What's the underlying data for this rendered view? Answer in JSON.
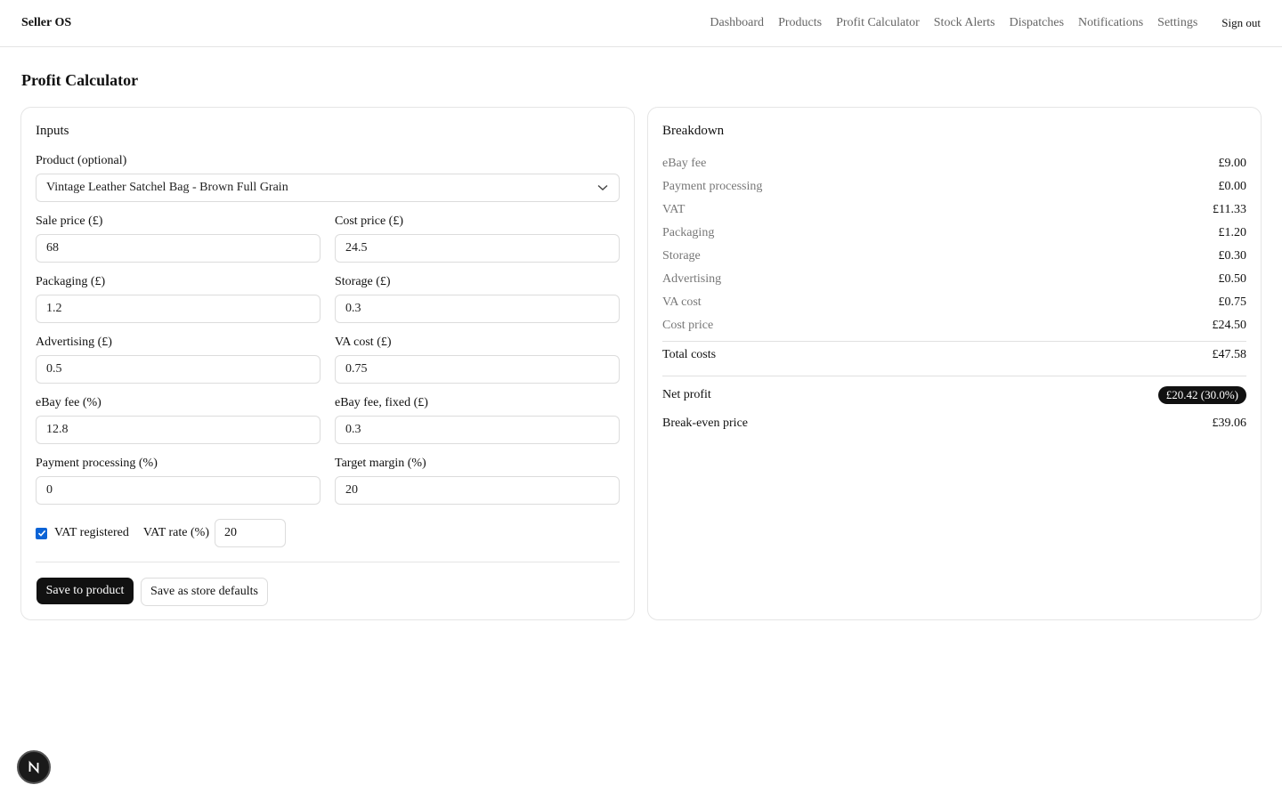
{
  "header": {
    "brand": "Seller OS",
    "nav": [
      "Dashboard",
      "Products",
      "Profit Calculator",
      "Stock Alerts",
      "Dispatches",
      "Notifications",
      "Settings"
    ],
    "sign_out": "Sign out"
  },
  "page_title": "Profit Calculator",
  "inputs": {
    "title": "Inputs",
    "product_label": "Product (optional)",
    "product_value": "Vintage Leather Satchel Bag - Brown Full Grain",
    "sale_price_label": "Sale price (£)",
    "sale_price": "68",
    "cost_price_label": "Cost price (£)",
    "cost_price": "24.5",
    "packaging_label": "Packaging (£)",
    "packaging": "1.2",
    "storage_label": "Storage (£)",
    "storage": "0.3",
    "advertising_label": "Advertising (£)",
    "advertising": "0.5",
    "va_cost_label": "VA cost (£)",
    "va_cost": "0.75",
    "ebay_fee_label": "eBay fee (%)",
    "ebay_fee": "12.8",
    "ebay_fee_fixed_label": "eBay fee, fixed (£)",
    "ebay_fee_fixed": "0.3",
    "payment_processing_label": "Payment processing (%)",
    "payment_processing": "0",
    "target_margin_label": "Target margin (%)",
    "target_margin": "20",
    "vat_registered_label": "VAT registered",
    "vat_registered": true,
    "vat_rate_label": "VAT rate (%)",
    "vat_rate": "20",
    "save_product": "Save to product",
    "save_defaults": "Save as store defaults"
  },
  "breakdown": {
    "title": "Breakdown",
    "rows": [
      {
        "label": "eBay fee",
        "value": "£9.00"
      },
      {
        "label": "Payment processing",
        "value": "£0.00"
      },
      {
        "label": "VAT",
        "value": "£11.33"
      },
      {
        "label": "Packaging",
        "value": "£1.20"
      },
      {
        "label": "Storage",
        "value": "£0.30"
      },
      {
        "label": "Advertising",
        "value": "£0.50"
      },
      {
        "label": "VA cost",
        "value": "£0.75"
      },
      {
        "label": "Cost price",
        "value": "£24.50"
      }
    ],
    "total_label": "Total costs",
    "total_value": "£47.58",
    "net_profit_label": "Net profit",
    "net_profit_value": "£20.42 (30.0%)",
    "break_even_label": "Break-even price",
    "break_even_value": "£39.06"
  },
  "colors": {
    "accent": "#111111",
    "checkbox": "#0b63d6",
    "muted_text": "#666666"
  }
}
